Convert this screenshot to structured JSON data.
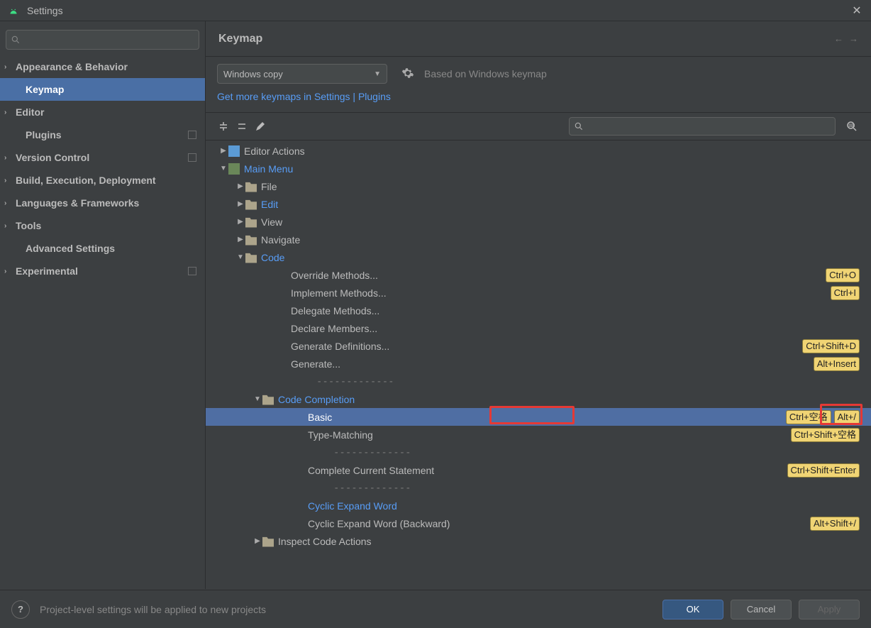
{
  "window": {
    "title": "Settings"
  },
  "sidebar": {
    "items": [
      {
        "label": "Appearance & Behavior",
        "expandable": true
      },
      {
        "label": "Keymap",
        "selected": true,
        "nested": true
      },
      {
        "label": "Editor",
        "expandable": true
      },
      {
        "label": "Plugins",
        "nested": true,
        "badge": true
      },
      {
        "label": "Version Control",
        "expandable": true,
        "badge": true
      },
      {
        "label": "Build, Execution, Deployment",
        "expandable": true
      },
      {
        "label": "Languages & Frameworks",
        "expandable": true
      },
      {
        "label": "Tools",
        "expandable": true
      },
      {
        "label": "Advanced Settings",
        "nested": true
      },
      {
        "label": "Experimental",
        "expandable": true,
        "badge": true
      }
    ]
  },
  "content": {
    "heading": "Keymap",
    "dropdown_value": "Windows copy",
    "based_on": "Based on Windows keymap",
    "link_text": "Get more keymaps in Settings | Plugins"
  },
  "tree": [
    {
      "indent": 0,
      "chev": "▶",
      "icon": "actions",
      "label": "Editor Actions"
    },
    {
      "indent": 0,
      "chev": "▼",
      "icon": "menu",
      "label": "Main Menu",
      "hl": true
    },
    {
      "indent": 1,
      "chev": "▶",
      "icon": "folder",
      "label": "File"
    },
    {
      "indent": 1,
      "chev": "▶",
      "icon": "folder",
      "label": "Edit",
      "hl": true
    },
    {
      "indent": 1,
      "chev": "▶",
      "icon": "folder",
      "label": "View"
    },
    {
      "indent": 1,
      "chev": "▶",
      "icon": "folder",
      "label": "Navigate"
    },
    {
      "indent": 1,
      "chev": "▼",
      "icon": "folder",
      "label": "Code",
      "hl": true
    },
    {
      "indent": 2,
      "label": "Override Methods...",
      "shortcuts": [
        "Ctrl+O"
      ]
    },
    {
      "indent": 2,
      "label": "Implement Methods...",
      "shortcuts": [
        "Ctrl+I"
      ]
    },
    {
      "indent": 2,
      "label": "Delegate Methods..."
    },
    {
      "indent": 2,
      "label": "Declare Members..."
    },
    {
      "indent": 2,
      "label": "Generate Definitions...",
      "shortcuts": [
        "Ctrl+Shift+D"
      ]
    },
    {
      "indent": 2,
      "label": "Generate...",
      "shortcuts": [
        "Alt+Insert"
      ]
    },
    {
      "indent": 2,
      "sep": true
    },
    {
      "indent": 2,
      "chev": "▼",
      "icon": "folder",
      "label": "Code Completion",
      "hl": true
    },
    {
      "indent": 3,
      "label": "Basic",
      "selected": true,
      "shortcuts": [
        "Ctrl+空格",
        "Alt+/"
      ],
      "redbox_label": true,
      "redbox_shortcut": true
    },
    {
      "indent": 3,
      "label": "Type-Matching",
      "shortcuts": [
        "Ctrl+Shift+空格"
      ]
    },
    {
      "indent": 3,
      "sep": true
    },
    {
      "indent": 3,
      "label": "Complete Current Statement",
      "shortcuts": [
        "Ctrl+Shift+Enter"
      ]
    },
    {
      "indent": 3,
      "sep": true
    },
    {
      "indent": 3,
      "label": "Cyclic Expand Word",
      "hl": true
    },
    {
      "indent": 3,
      "label": "Cyclic Expand Word (Backward)",
      "shortcuts": [
        "Alt+Shift+/"
      ]
    },
    {
      "indent": 2,
      "chev": "▶",
      "icon": "folder",
      "label": "Inspect Code Actions"
    }
  ],
  "footer": {
    "hint": "Project-level settings will be applied to new projects",
    "ok": "OK",
    "cancel": "Cancel",
    "apply": "Apply"
  }
}
